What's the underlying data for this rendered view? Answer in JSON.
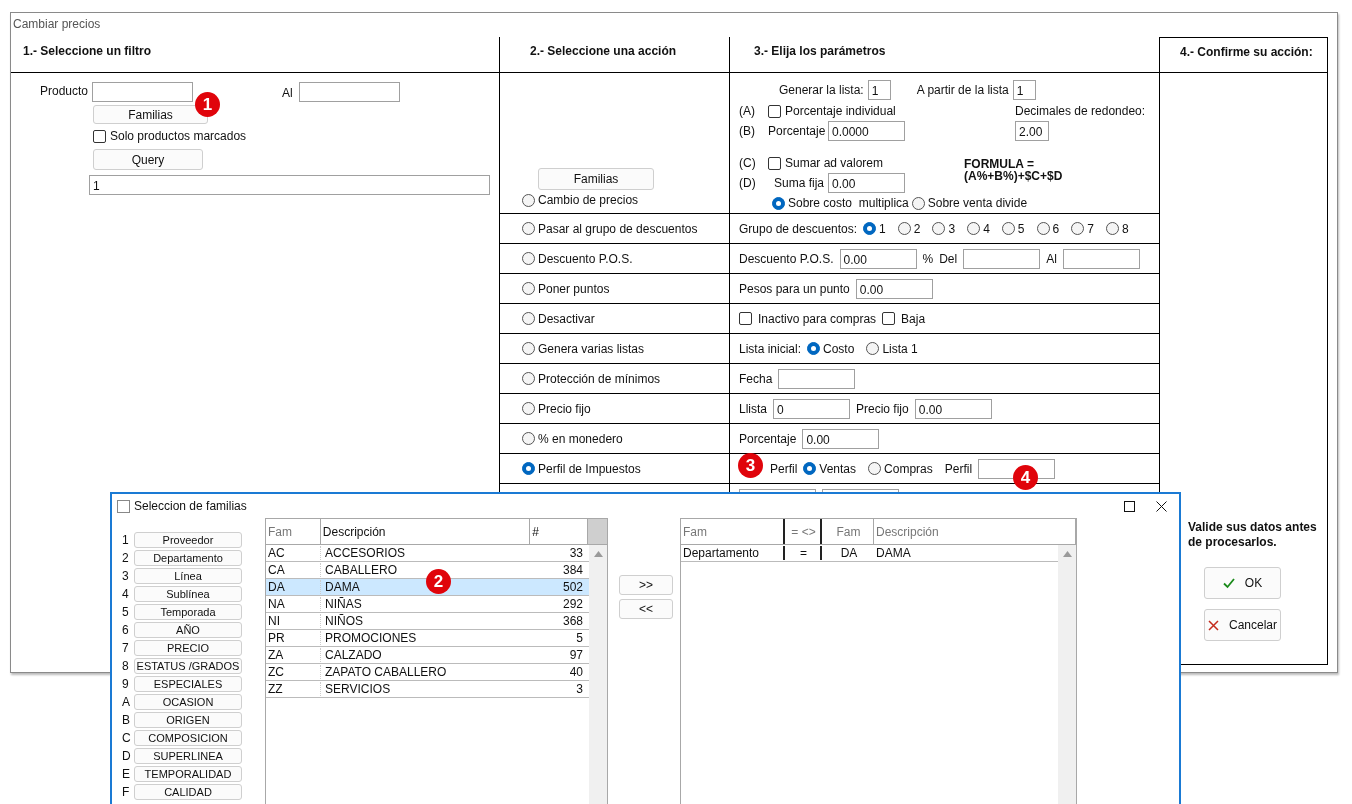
{
  "window": {
    "title": "Cambiar precios"
  },
  "headers": [
    "1.- Seleccione un filtro",
    "2.- Seleccione una acción",
    "3.- Elija los parámetros",
    "4.- Confirme su acción:"
  ],
  "filter": {
    "producto_label": "Producto",
    "al_label": "Al",
    "familias_button": "Familias",
    "solo_marcados": {
      "label": "Solo productos marcados",
      "checked": false
    },
    "query_button": "Query",
    "query_value": "1"
  },
  "actions_familias_button": "Familias",
  "actions": [
    {
      "label": "Cambio de precios",
      "selected": false
    },
    {
      "label": "Pasar al grupo de descuentos",
      "selected": false
    },
    {
      "label": "Descuento P.O.S.",
      "selected": false
    },
    {
      "label": "Poner puntos",
      "selected": false
    },
    {
      "label": "Desactivar",
      "selected": false
    },
    {
      "label": "Genera varias listas",
      "selected": false
    },
    {
      "label": "Protección de mínimos",
      "selected": false
    },
    {
      "label": "Precio fijo",
      "selected": false
    },
    {
      "label": "% en monedero",
      "selected": false
    },
    {
      "label": "Perfil de Impuestos",
      "selected": true
    }
  ],
  "pricing": {
    "generar_label": "Generar la lista:",
    "generar_value": "1",
    "apartir_label": "A partir de la lista",
    "apartir_value": "1",
    "a_tag": "(A)",
    "porcentaje_individual": {
      "label": "Porcentaje individual",
      "checked": false
    },
    "decimales_label": "Decimales de redondeo:",
    "decimales_value": "2.00",
    "b_tag": "(B)",
    "porcentaje_label": "Porcentaje",
    "porcentaje_value": "0.0000",
    "c_tag": "(C)",
    "ad_valorem": {
      "label": "Sumar ad valorem",
      "checked": false
    },
    "formula": [
      "FORMULA =",
      "(A%+B%)+$C+$D"
    ],
    "d_tag": "(D)",
    "suma_fija_label": "Suma fija",
    "suma_fija_value": "0.00",
    "modes": [
      {
        "label": "Sobre costo  multiplica",
        "selected": true
      },
      {
        "label": "Sobre venta divide",
        "selected": false
      }
    ]
  },
  "params": [
    {
      "items": [
        {
          "kind": "label",
          "text": "Grupo de descuentos:"
        },
        {
          "kind": "radio",
          "text": "1",
          "selected": true
        },
        {
          "kind": "radio",
          "text": "2",
          "selected": false
        },
        {
          "kind": "radio",
          "text": "3",
          "selected": false
        },
        {
          "kind": "radio",
          "text": "4",
          "selected": false
        },
        {
          "kind": "radio",
          "text": "5",
          "selected": false
        },
        {
          "kind": "radio",
          "text": "6",
          "selected": false
        },
        {
          "kind": "radio",
          "text": "7",
          "selected": false
        },
        {
          "kind": "radio",
          "text": "8",
          "selected": false
        }
      ]
    },
    {
      "items": [
        {
          "kind": "label",
          "text": "Descuento P.O.S."
        },
        {
          "kind": "input",
          "value": "0.00"
        },
        {
          "kind": "label",
          "text": "%"
        },
        {
          "kind": "label",
          "text": "Del"
        },
        {
          "kind": "input"
        },
        {
          "kind": "label",
          "text": "Al"
        },
        {
          "kind": "input"
        }
      ]
    },
    {
      "items": [
        {
          "kind": "label",
          "text": "Pesos para un punto"
        },
        {
          "kind": "input",
          "value": "0.00"
        }
      ]
    },
    {
      "items": [
        {
          "kind": "checkbox",
          "text": "Inactivo para compras",
          "checked": false
        },
        {
          "kind": "checkbox",
          "text": "Baja",
          "checked": false
        }
      ]
    },
    {
      "items": [
        {
          "kind": "label",
          "text": "Lista inicial:"
        },
        {
          "kind": "radio",
          "text": "Costo",
          "selected": true
        },
        {
          "kind": "radio",
          "text": "Lista 1",
          "selected": false
        }
      ]
    },
    {
      "items": [
        {
          "kind": "label",
          "text": "Fecha"
        },
        {
          "kind": "input"
        }
      ]
    },
    {
      "items": [
        {
          "kind": "label",
          "text": "Llista"
        },
        {
          "kind": "input",
          "value": "0"
        },
        {
          "kind": "label",
          "text": "Precio fijo"
        },
        {
          "kind": "input",
          "value": "0.00"
        }
      ]
    },
    {
      "items": [
        {
          "kind": "label",
          "text": "Porcentaje"
        },
        {
          "kind": "input",
          "value": "0.00"
        }
      ]
    },
    {
      "items": [
        {
          "kind": "label",
          "text": "Perfil"
        },
        {
          "kind": "radio",
          "text": "Ventas",
          "selected": true
        },
        {
          "kind": "radio",
          "text": "Compras",
          "selected": false
        },
        {
          "kind": "label",
          "text": "Perfil"
        },
        {
          "kind": "input"
        }
      ]
    },
    {
      "items": [
        {
          "kind": "input"
        },
        {
          "kind": "input"
        }
      ]
    }
  ],
  "confirm": {
    "note": "Valide sus datos antes de procesarlos.",
    "ok": "OK",
    "cancel": "Cancelar"
  },
  "dialog": {
    "title": "Seleccion de familias",
    "categories": [
      {
        "key": "1",
        "label": "Proveedor"
      },
      {
        "key": "2",
        "label": "Departamento"
      },
      {
        "key": "3",
        "label": "Línea"
      },
      {
        "key": "4",
        "label": "Sublínea"
      },
      {
        "key": "5",
        "label": "Temporada"
      },
      {
        "key": "6",
        "label": "AÑO"
      },
      {
        "key": "7",
        "label": "PRECIO"
      },
      {
        "key": "8",
        "label": "ESTATUS /GRADOS"
      },
      {
        "key": "9",
        "label": "ESPECIALES"
      },
      {
        "key": "A",
        "label": "OCASION"
      },
      {
        "key": "B",
        "label": "ORIGEN"
      },
      {
        "key": "C",
        "label": "COMPOSICION"
      },
      {
        "key": "D",
        "label": "SUPERLINEA"
      },
      {
        "key": "E",
        "label": "TEMPORALIDAD"
      },
      {
        "key": "F",
        "label": "CALIDAD"
      }
    ],
    "table": {
      "columns": [
        "Fam",
        "Descripción",
        "#"
      ],
      "rows": [
        {
          "fam": "AC",
          "desc": "ACCESORIOS",
          "count": "33",
          "selected": false
        },
        {
          "fam": "CA",
          "desc": "CABALLERO",
          "count": "384",
          "selected": false
        },
        {
          "fam": "DA",
          "desc": "DAMA",
          "count": "502",
          "selected": true
        },
        {
          "fam": "NA",
          "desc": "NIÑAS",
          "count": "292",
          "selected": false
        },
        {
          "fam": "NI",
          "desc": "NIÑOS",
          "count": "368",
          "selected": false
        },
        {
          "fam": "PR",
          "desc": "PROMOCIONES",
          "count": "5",
          "selected": false
        },
        {
          "fam": "ZA",
          "desc": "CALZADO",
          "count": "97",
          "selected": false
        },
        {
          "fam": "ZC",
          "desc": "ZAPATO CABALLERO",
          "count": "40",
          "selected": false
        },
        {
          "fam": "ZZ",
          "desc": "SERVICIOS",
          "count": "3",
          "selected": false
        }
      ]
    },
    "add_button": ">>",
    "remove_button": "<<",
    "criteria": {
      "columns": [
        "Fam",
        "= <>",
        "Fam",
        "Descripción"
      ],
      "rows": [
        {
          "field": "Departamento",
          "op": "=",
          "fam": "DA",
          "desc": "DAMA"
        }
      ]
    }
  },
  "annotations": [
    "1",
    "2",
    "3",
    "4"
  ]
}
